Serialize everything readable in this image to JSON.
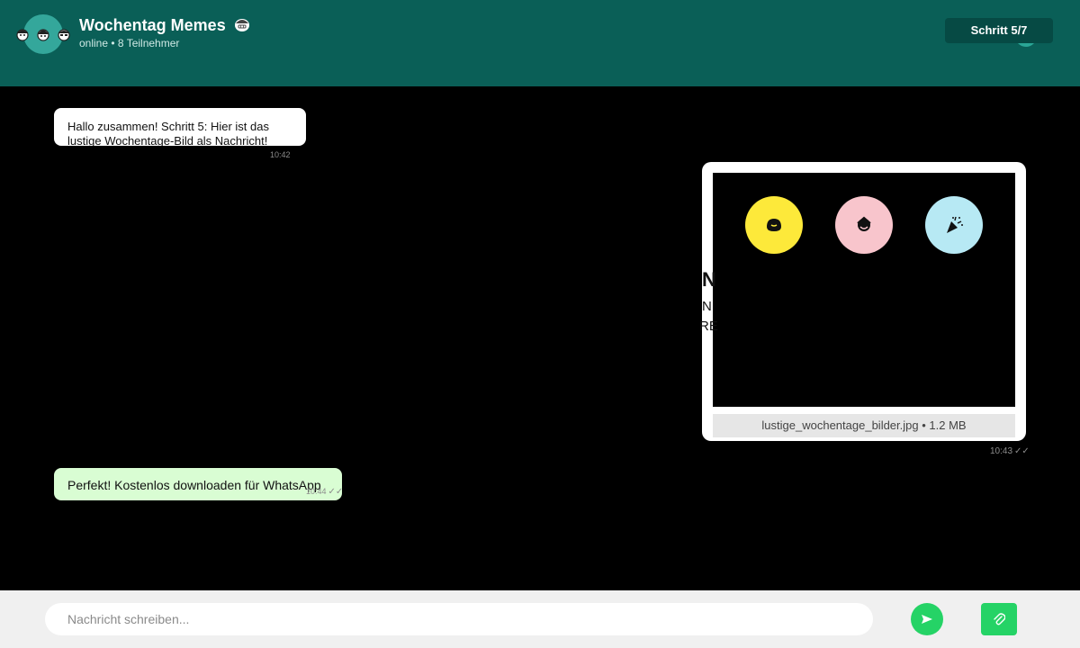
{
  "header": {
    "title": "Wochentag Memes",
    "title_emoji_icon": "grimace-face-icon",
    "subtitle": "online • 8 Teilnehmer",
    "step_label": "Schritt 5/7",
    "avatar_icons": [
      "person-face-icon",
      "person-face-icon",
      "person-face-icon"
    ]
  },
  "messages": {
    "incoming": {
      "text": "Hallo zusammen! Schritt 5: Hier ist das lustige Wochentage-Bild als Nachricht!",
      "time": "10:42"
    },
    "image": {
      "filename_caption": "lustige_wochentage_bilder.jpg • 1.2 MB",
      "time": "10:43",
      "status": "✓✓",
      "stickers": [
        "smiling-blob-icon",
        "happy-face-icon",
        "party-popper-icon"
      ],
      "edge_text": [
        "N",
        "N",
        "RE"
      ]
    },
    "outgoing": {
      "text": "Perfekt! Kostenlos downloaden für WhatsApp",
      "time": "10:44",
      "status": "✓✓"
    }
  },
  "footer": {
    "input_placeholder": "Nachricht schreiben...",
    "send_icon": "send-arrow-icon",
    "attach_icon": "paperclip-icon"
  },
  "colors": {
    "header_bg": "#0a5f57",
    "step_pill_bg": "#064a44",
    "outgoing_bubble": "#d9fdd3",
    "send_green": "#25d366"
  }
}
